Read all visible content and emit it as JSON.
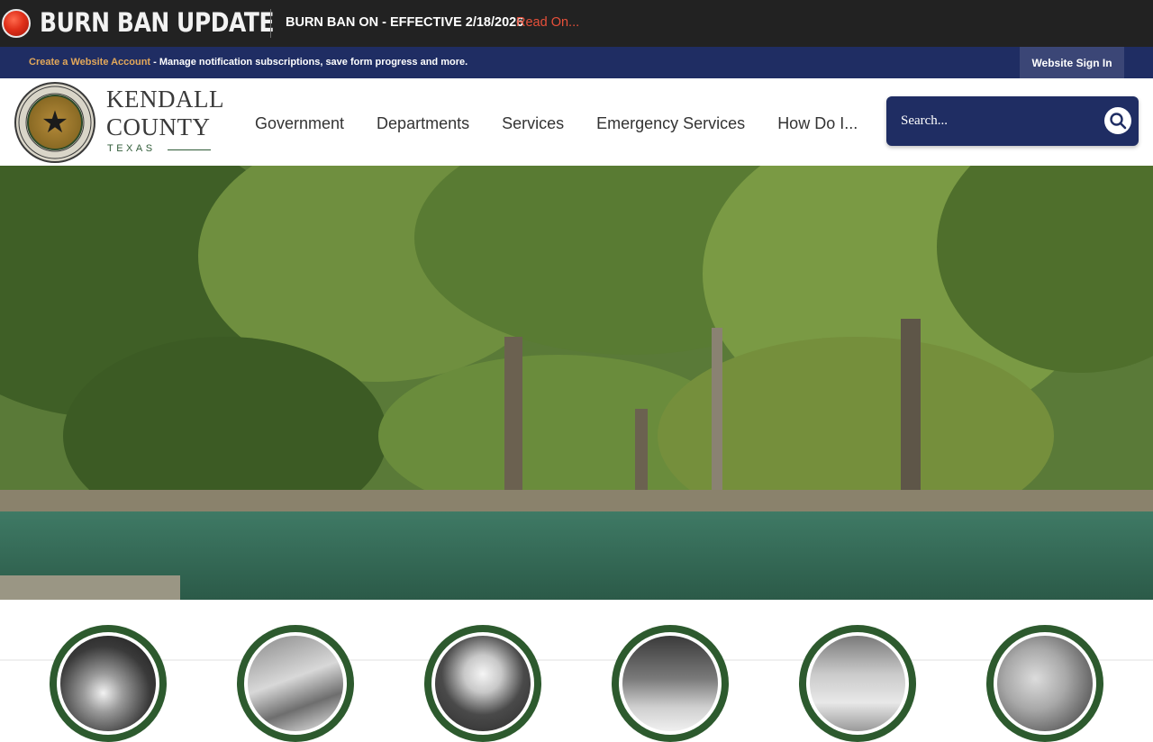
{
  "alert": {
    "title": "BURN BAN UPDATE",
    "message": "BURN BAN ON - EFFECTIVE 2/18/2026",
    "link": "Read On..."
  },
  "account": {
    "create_link": "Create a Website Account",
    "description": " - Manage notification subscriptions, save form progress and more.",
    "signin": "Website Sign In"
  },
  "brand": {
    "line1": "KENDALL",
    "line2": "COUNTY",
    "state": "TEXAS"
  },
  "nav": {
    "items": [
      {
        "label": "Government"
      },
      {
        "label": "Departments"
      },
      {
        "label": "Services"
      },
      {
        "label": "Emergency Services"
      },
      {
        "label": "How Do I..."
      }
    ]
  },
  "search": {
    "placeholder": "Search..."
  },
  "quick_links": [
    {
      "icon": "fire-icon"
    },
    {
      "icon": "chairs-notebook-icon"
    },
    {
      "icon": "megaphone-icon"
    },
    {
      "icon": "magnifier-documents-icon"
    },
    {
      "icon": "vote-flag-icon"
    },
    {
      "icon": "approved-stamp-icon"
    }
  ],
  "colors": {
    "alert_bg": "#222222",
    "account_bg": "#1f2d63",
    "search_bg": "#1f2d63",
    "accent_green": "#2d5a2e",
    "link_orange": "#e3a85a",
    "alert_red": "#e8503a"
  }
}
